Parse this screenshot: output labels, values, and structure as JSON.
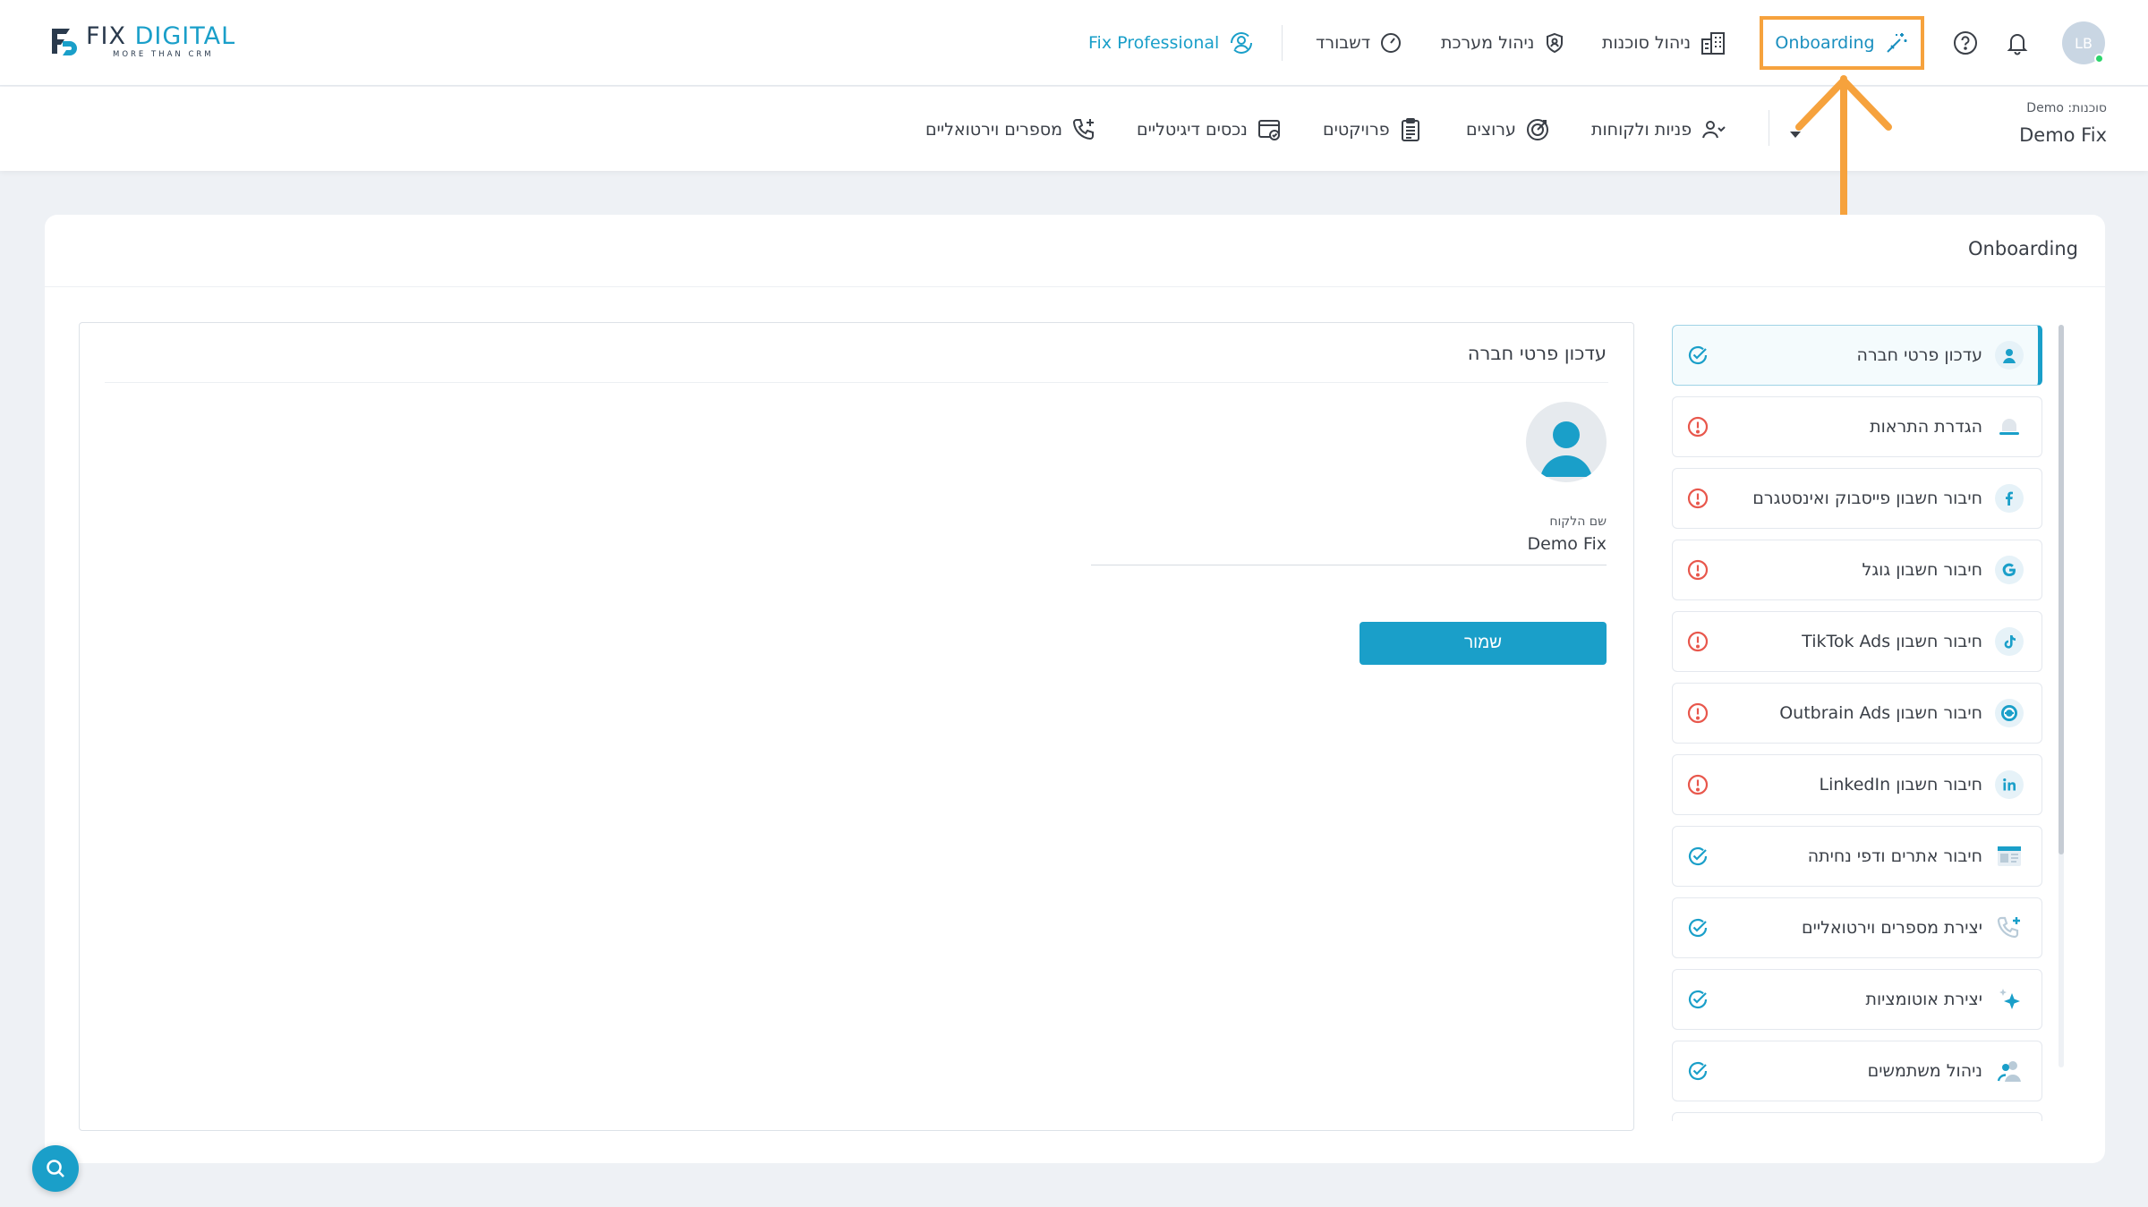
{
  "brand": {
    "word_primary": "FIX",
    "word_secondary": "DIGITAL",
    "tagline": "MORE THAN CRM"
  },
  "topnav": {
    "pro_label": "Fix Professional",
    "dashboard_label": "דשבורד",
    "system_label": "ניהול מערכת",
    "agencies_label": "ניהול סוכנות",
    "onboarding_label": "Onboarding",
    "user_initials": "LB"
  },
  "subnav": {
    "agency_label": "סוכנות: Demo",
    "agency_name": "Demo Fix",
    "items": [
      {
        "label": "פניות ולקוחות",
        "icon": "users-icon"
      },
      {
        "label": "ערוצים",
        "icon": "channels-icon"
      },
      {
        "label": "פרויקטים",
        "icon": "clipboard-icon"
      },
      {
        "label": "נכסים דיגיטליים",
        "icon": "assets-icon"
      },
      {
        "label": "מספרים וירטואליים",
        "icon": "phone-plus-icon"
      }
    ]
  },
  "page": {
    "title": "Onboarding"
  },
  "steps": [
    {
      "label": "עדכון פרטי חברה",
      "icon": "person-icon",
      "status": "done",
      "active": true
    },
    {
      "label": "הגדרת התראות",
      "icon": "bell-icon",
      "status": "warning"
    },
    {
      "label": "חיבור חשבון פייסבוק ואינסטגרם",
      "icon": "facebook-icon",
      "status": "warning"
    },
    {
      "label": "חיבור חשבון גוגל",
      "icon": "google-icon",
      "status": "warning"
    },
    {
      "label": "חיבור חשבון TikTok Ads",
      "icon": "tiktok-icon",
      "status": "warning"
    },
    {
      "label": "חיבור חשבון Outbrain Ads",
      "icon": "outbrain-icon",
      "status": "warning"
    },
    {
      "label": "חיבור חשבון LinkedIn",
      "icon": "linkedin-icon",
      "status": "warning"
    },
    {
      "label": "חיבור אתרים ודפי נחיתה",
      "icon": "website-icon",
      "status": "done"
    },
    {
      "label": "יצירת מספרים וירטואליים",
      "icon": "phone-plus-icon",
      "status": "done"
    },
    {
      "label": "יצירת אוטומציות",
      "icon": "sparkle-icon",
      "status": "done"
    },
    {
      "label": "ניהול משתמשים",
      "icon": "users-icon",
      "status": "done"
    }
  ],
  "form": {
    "title": "עדכון פרטי חברה",
    "name_label": "שם הלקוח",
    "name_value": "Demo Fix",
    "save_label": "שמור"
  },
  "colors": {
    "accent": "#1a9fc9",
    "highlight": "#f6a23d",
    "warning": "#e8574c",
    "success": "#1a9fc9"
  }
}
